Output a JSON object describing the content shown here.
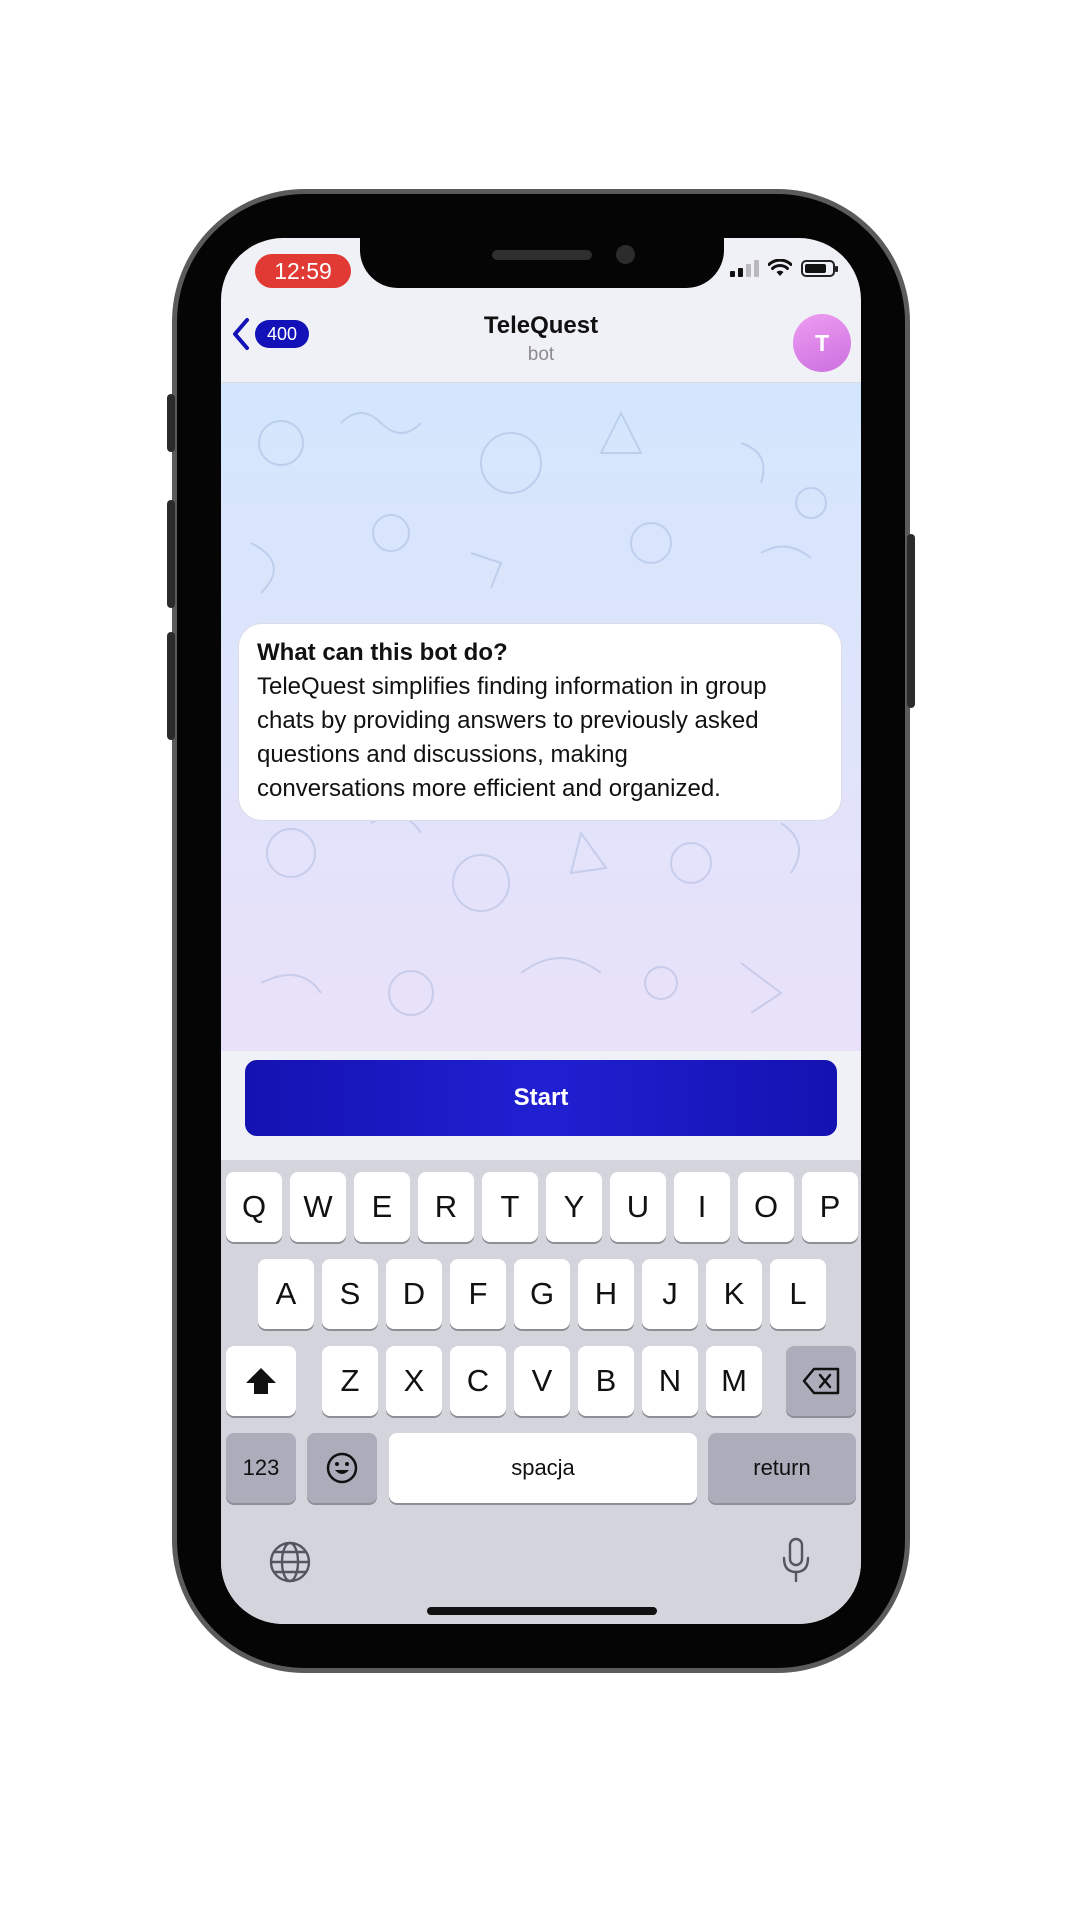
{
  "status_bar": {
    "time": "12:59"
  },
  "nav": {
    "back_count": "400",
    "title": "TeleQuest",
    "subtitle": "bot",
    "avatar_letter": "T"
  },
  "message": {
    "title": "What can this bot do?",
    "lines": [
      "TeleQuest simplifies finding information in group",
      "chats by providing answers to previously asked",
      "questions and discussions, making",
      "conversations more efficient and organized."
    ]
  },
  "start_button": {
    "label": "Start"
  },
  "keyboard": {
    "row1": [
      "Q",
      "W",
      "E",
      "R",
      "T",
      "Y",
      "U",
      "I",
      "O",
      "P"
    ],
    "row2": [
      "A",
      "S",
      "D",
      "F",
      "G",
      "H",
      "J",
      "K",
      "L"
    ],
    "row3": [
      "Z",
      "X",
      "C",
      "V",
      "B",
      "N",
      "M"
    ],
    "numbers_label": "123",
    "space_label": "spacja",
    "return_label": "return",
    "icons": [
      "shift-icon",
      "backspace-icon",
      "emoji-icon",
      "globe-icon",
      "microphone-icon"
    ]
  },
  "colors": {
    "accent": "#1412b0",
    "time_pill": "#e13a35",
    "avatar": "#dd86ea"
  }
}
